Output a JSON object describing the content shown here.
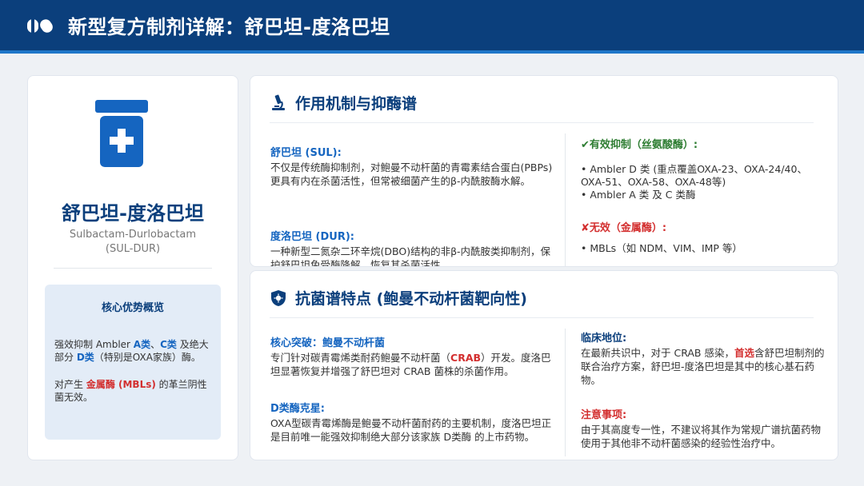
{
  "header": {
    "title": "新型复方制剂详解：舒巴坦-度洛巴坦",
    "logo_icon": "pill-capsule-icon",
    "bg_color": "#0b3f7c"
  },
  "left_card": {
    "icon": "medicine-bottle-icon",
    "name_cn": "舒巴坦-度洛巴坦",
    "name_en": "Sulbactam-Durlobactam",
    "abbrev": "(SUL-DUR)",
    "advantages": {
      "title": "核心优势概览",
      "p1": {
        "pre": "强效抑制 Ambler ",
        "a": "A类",
        "sep": "、",
        "c": "C类",
        "mid": " 及绝大部分 ",
        "d": "D类",
        "post": "（特别是OXA家族）酶。"
      },
      "p2": {
        "pre": "对产生 ",
        "mbl": "金属酶 (MBLs)",
        "post": " 的革兰阴性菌无效。"
      }
    }
  },
  "mechanism": {
    "icon": "microscope-icon",
    "title": "作用机制与抑酶谱",
    "sul_title": "舒巴坦 (SUL):",
    "sul_text": "不仅是传统酶抑制剂，对鲍曼不动杆菌的青霉素结合蛋白(PBPs)更具有内在杀菌活性，但常被细菌产生的β-内酰胺酶水解。",
    "dur_title": "度洛巴坦 (DUR):",
    "dur_text": "一种新型二氮杂二环辛烷(DBO)结构的非β-内酰胺类抑制剂，保护舒巴坦免受酶降解，恢复其杀菌活性。",
    "effective_title": "✔有效抑制（丝氨酸酶）:",
    "effective_items": [
      "• Ambler D 类 (重点覆盖OXA-23、OXA-24/40、OXA-51、OXA-58、OXA-48等)",
      "• Ambler A 类 及 C 类酶"
    ],
    "ineffective_title": "✘无效（金属酶）:",
    "ineffective_items": [
      "• MBLs（如 NDM、VIM、IMP 等）"
    ]
  },
  "spectrum": {
    "icon": "shield-virus-icon",
    "title": "抗菌谱特点 (鲍曼不动杆菌靶向性)",
    "core_title": "核心突破：鲍曼不动杆菌",
    "core_text_pre": "专门针对碳青霉烯类耐药鲍曼不动杆菌（",
    "core_text_hl": "CRAB",
    "core_text_post": "）开发。度洛巴坦显著恢复并增强了舒巴坦对 CRAB 菌株的杀菌作用。",
    "d_title": "D类酶克星:",
    "d_text": "OXA型碳青霉烯酶是鲍曼不动杆菌耐药的主要机制，度洛巴坦正是目前唯一能强效抑制绝大部分该家族 D类酶 的上市药物。",
    "clinical_title": "临床地位:",
    "clinical_text_pre": "在最新共识中，对于 CRAB 感染，",
    "clinical_text_hl": "首选",
    "clinical_text_post": "含舒巴坦制剂的联合治疗方案，舒巴坦-度洛巴坦是其中的核心基石药物。",
    "caution_title": "注意事项:",
    "caution_text": "由于其高度专一性，不建议将其作为常规广谱抗菌药物使用于其他非不动杆菌感染的经验性治疗中。"
  }
}
